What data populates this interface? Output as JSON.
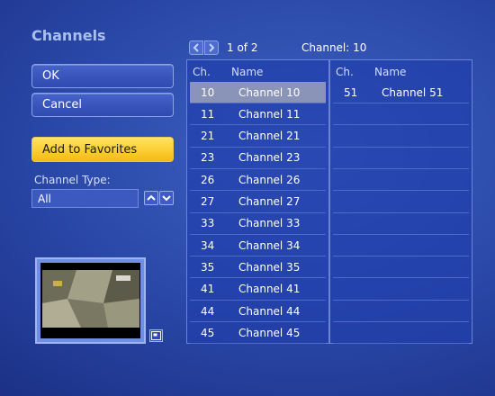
{
  "window": {
    "title": "Channels"
  },
  "actions": {
    "ok_label": "OK",
    "cancel_label": "Cancel",
    "favorites_label": "Add to Favorites"
  },
  "filter": {
    "type_label": "Channel Type:",
    "type_value": "All"
  },
  "pager": {
    "page_text": "1 of 2",
    "current_channel_text": "Channel: 10"
  },
  "list": {
    "col_number": "Ch.",
    "col_name": "Name",
    "left_rows": [
      {
        "num": "10",
        "name": "Channel 10",
        "selected": true
      },
      {
        "num": "11",
        "name": "Channel 11"
      },
      {
        "num": "21",
        "name": "Channel 21"
      },
      {
        "num": "23",
        "name": "Channel 23"
      },
      {
        "num": "26",
        "name": "Channel 26"
      },
      {
        "num": "27",
        "name": "Channel 27"
      },
      {
        "num": "33",
        "name": "Channel 33"
      },
      {
        "num": "34",
        "name": "Channel 34"
      },
      {
        "num": "35",
        "name": "Channel 35"
      },
      {
        "num": "41",
        "name": "Channel 41"
      },
      {
        "num": "44",
        "name": "Channel 44"
      },
      {
        "num": "45",
        "name": "Channel 45"
      }
    ],
    "right_rows": [
      {
        "num": "51",
        "name": "Channel 51"
      }
    ],
    "right_empty_rows": 11
  },
  "icons": {
    "pager_prev": "chevron-left-icon",
    "pager_next": "chevron-right-icon",
    "scroll_up": "chevron-up-icon",
    "scroll_down": "chevron-down-icon",
    "expand": "expand-icon"
  },
  "colors": {
    "accent_yellow": "#f6bc10",
    "selected_row": "#8a94b8",
    "title_text": "#a9bff0"
  }
}
